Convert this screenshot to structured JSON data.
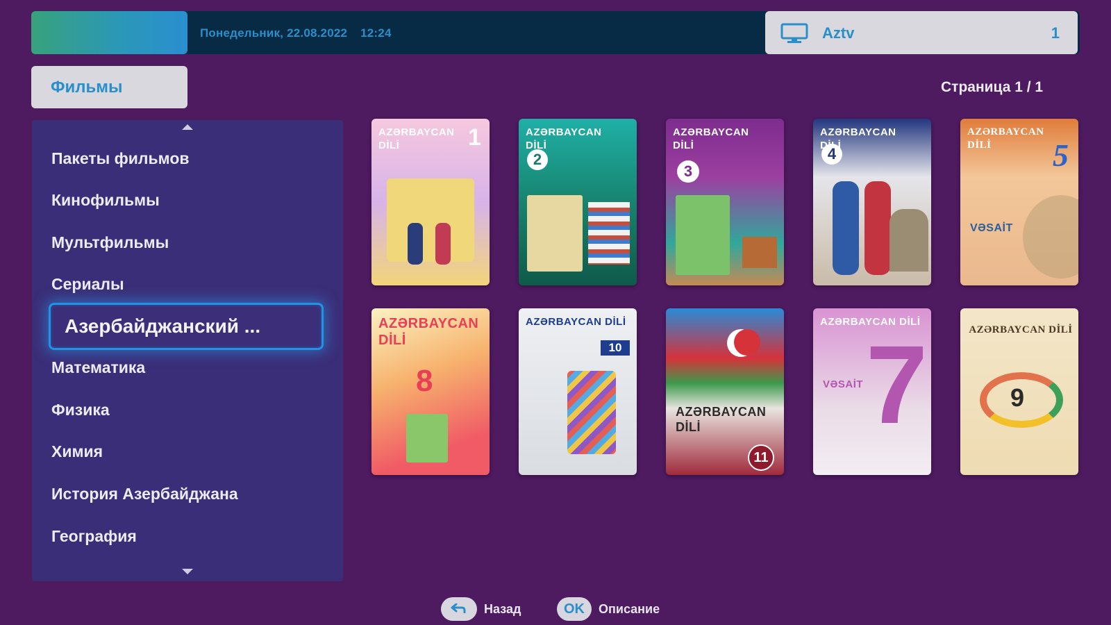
{
  "header": {
    "datetime": "Понедельник, 22.08.2022",
    "time": "12:24",
    "channel_icon": "tv-monitor-icon",
    "channel_name": "Aztv",
    "channel_number": "1"
  },
  "section": {
    "label": "Фильмы"
  },
  "pagination": {
    "label": "Страница 1 / 1"
  },
  "sidebar": {
    "items": [
      {
        "label": "Пакеты фильмов"
      },
      {
        "label": "Кинофильмы"
      },
      {
        "label": "Мультфильмы"
      },
      {
        "label": "Сериалы"
      },
      {
        "label": "Азербайджанский ..."
      },
      {
        "label": "Математика"
      },
      {
        "label": "Физика"
      },
      {
        "label": "Химия"
      },
      {
        "label": "История Азербайджана"
      },
      {
        "label": "География"
      }
    ],
    "selected_index": 4
  },
  "covers": [
    {
      "title": "AZƏRBAYCAN DİLİ",
      "number": "1",
      "color": "#f1a7c9"
    },
    {
      "title": "AZƏRBAYCAN DİLİ",
      "number": "2",
      "color": "#1f8f7b"
    },
    {
      "title": "AZƏRBAYCAN DİLİ",
      "number": "3",
      "color": "#8d2f92"
    },
    {
      "title": "AZƏRBAYCAN DİLİ",
      "number": "4",
      "color": "#2c3f8f"
    },
    {
      "title": "AZƏRBAYCAN DİLİ",
      "number": "5",
      "color": "#e07c3a",
      "subtitle": "VƏSAİT"
    },
    {
      "title": "AZƏRBAYCAN DİLİ",
      "number": "8",
      "color": "#f25c66"
    },
    {
      "title": "AZƏRBAYCAN DİLİ",
      "number": "10",
      "color": "#e7e8ec"
    },
    {
      "title": "AZƏRBAYCAN DİLİ",
      "number": "11",
      "color": "#a12a3c"
    },
    {
      "title": "AZƏRBAYCAN DİLİ",
      "number": "7",
      "color": "#d993d2",
      "subtitle": "VƏSAİT"
    },
    {
      "title": "AZƏRBAYCAN DİLİ",
      "number": "9",
      "color": "#f0e2c2"
    }
  ],
  "footer": {
    "back_label": "Назад",
    "ok_key": "OK",
    "ok_label": "Описание"
  }
}
